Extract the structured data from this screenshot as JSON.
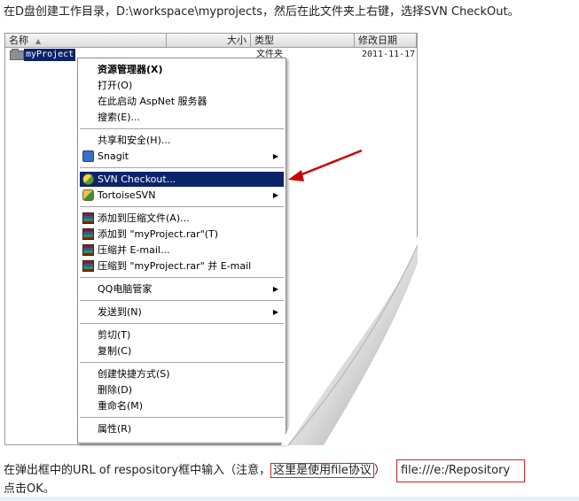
{
  "intro_text": "在D盘创建工作目录，D:\\workspace\\myprojects，然后在此文件夹上右键，选择SVN CheckOut。",
  "explorer": {
    "columns": {
      "name": "名称",
      "size": "大小",
      "type": "类型",
      "date": "修改日期"
    },
    "row": {
      "name": "myProject",
      "type": "文件夹",
      "date": "2011-11-17"
    }
  },
  "menu": {
    "items": [
      {
        "label": "资源管理器(X)",
        "bold": true,
        "icon": "",
        "submenu": false
      },
      {
        "label": "打开(O)",
        "icon": "",
        "submenu": false
      },
      {
        "label": "在此启动 AspNet 服务器",
        "icon": "",
        "submenu": false
      },
      {
        "label": "搜索(E)...",
        "icon": "",
        "submenu": false
      },
      {
        "separator": true
      },
      {
        "label": "共享和安全(H)...",
        "icon": "",
        "submenu": false
      },
      {
        "label": "Snagit",
        "icon": "snagit-icon",
        "submenu": true
      },
      {
        "separator": true
      },
      {
        "label": "SVN Checkout...",
        "icon": "svn-checkout-icon",
        "submenu": false,
        "highlighted": true
      },
      {
        "label": "TortoiseSVN",
        "icon": "tortoisesvn-icon",
        "submenu": true
      },
      {
        "separator": true
      },
      {
        "label": "添加到压缩文件(A)...",
        "icon": "winrar-icon",
        "submenu": false
      },
      {
        "label": "添加到 \"myProject.rar\"(T)",
        "icon": "winrar-icon",
        "submenu": false
      },
      {
        "label": "压缩并 E-mail...",
        "icon": "winrar-icon",
        "submenu": false
      },
      {
        "label": "压缩到 \"myProject.rar\" 并 E-mail",
        "icon": "winrar-icon",
        "submenu": false
      },
      {
        "separator": true
      },
      {
        "label": "QQ电脑管家",
        "icon": "",
        "submenu": true
      },
      {
        "separator": true
      },
      {
        "label": "发送到(N)",
        "icon": "",
        "submenu": true
      },
      {
        "separator": true
      },
      {
        "label": "剪切(T)",
        "icon": "",
        "submenu": false
      },
      {
        "label": "复制(C)",
        "icon": "",
        "submenu": false
      },
      {
        "separator": true
      },
      {
        "label": "创建快捷方式(S)",
        "icon": "",
        "submenu": false
      },
      {
        "label": "删除(D)",
        "icon": "",
        "submenu": false
      },
      {
        "label": "重命名(M)",
        "icon": "",
        "submenu": false
      },
      {
        "separator": true
      },
      {
        "label": "属性(R)",
        "icon": "",
        "submenu": false
      }
    ]
  },
  "outro": {
    "before": "在弹出框中的URL of respository框中输入（注意，",
    "note": "这里是使用file协议",
    "after": "）",
    "url": "file:///e:/Repository",
    "line2": "点击OK。"
  },
  "colors": {
    "highlight": "#0a246a",
    "annotation_red": "#e02020",
    "arrow_red": "#cc0000"
  }
}
